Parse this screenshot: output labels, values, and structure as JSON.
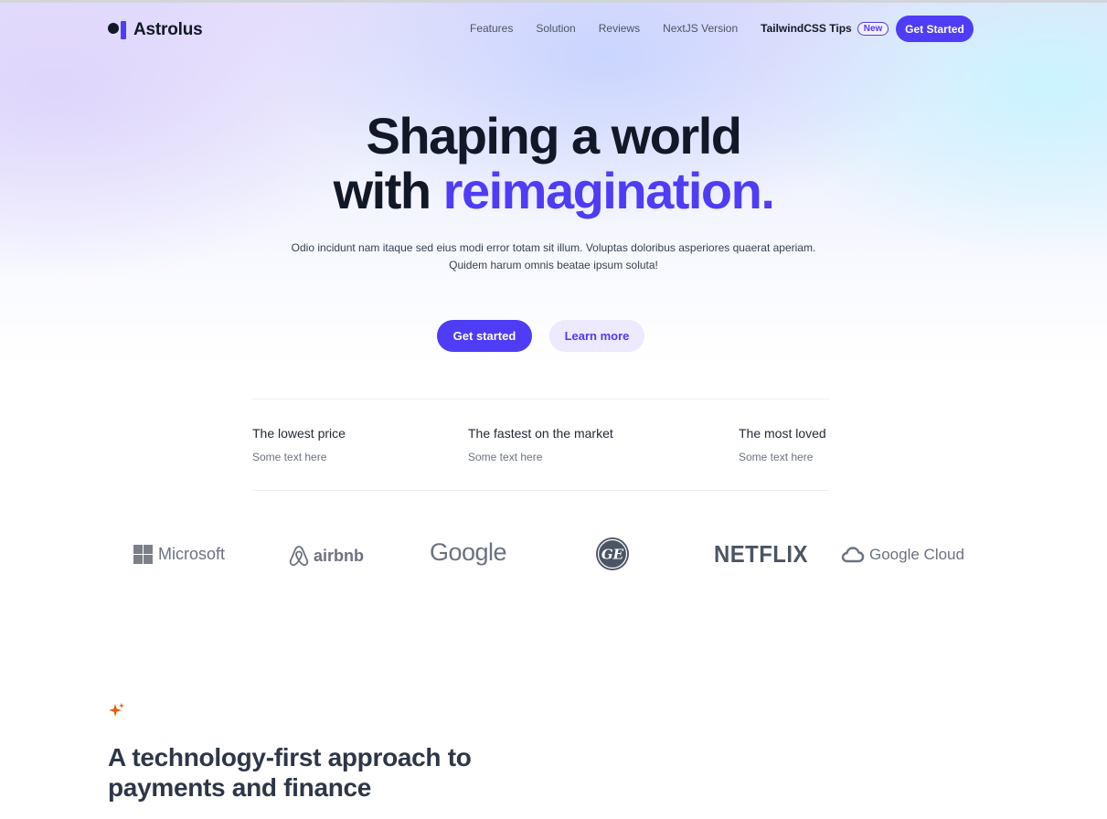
{
  "brand": {
    "name": "Astrolus",
    "accent_color": "#4f3cf6"
  },
  "nav": {
    "links": [
      "Features",
      "Solution",
      "Reviews",
      "NextJS Version",
      "TailwindCSS Tips"
    ],
    "badge": "New",
    "cta": "Get Started"
  },
  "hero": {
    "title_line1": "Shaping a world",
    "title_line2_prefix": "with",
    "title_line2_accent": "reimagination.",
    "subtitle_line1": "Odio incidunt nam itaque sed eius modi error totam sit illum. Voluptas doloribus asperiores quaerat aperiam.",
    "subtitle_line2": "Quidem harum omnis beatae ipsum soluta!",
    "primary_button": "Get started",
    "secondary_button": "Learn more"
  },
  "stats": [
    {
      "title": "The lowest price",
      "text": "Some text here"
    },
    {
      "title": "The fastest on the market",
      "text": "Some text here"
    },
    {
      "title": "The most loved",
      "text": "Some text here"
    }
  ],
  "logos": {
    "microsoft": "Microsoft",
    "airbnb": "airbnb",
    "google": "Google",
    "ge": "GE",
    "netflix": "NETFLIX",
    "google_cloud": "Google Cloud",
    "icons": [
      "microsoft-logo-icon",
      "airbnb-logo-icon",
      "ge-logo-icon",
      "google-cloud-logo-icon"
    ]
  },
  "section": {
    "icon": "sparkle-icon",
    "title_line1": "A technology-first approach to",
    "title_line2": "payments and finance"
  }
}
